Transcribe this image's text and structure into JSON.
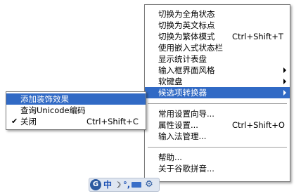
{
  "main_menu": {
    "items": [
      {
        "label": "切换为全角状态",
        "shortcut": ""
      },
      {
        "label": "切换为英文标点",
        "shortcut": ""
      },
      {
        "label": "切换为繁体模式",
        "shortcut": "Ctrl+Shift+T"
      },
      {
        "label": "使用嵌入式状态栏",
        "shortcut": ""
      },
      {
        "label": "显示统计表盘",
        "shortcut": ""
      },
      {
        "label": "输入框界面风格",
        "shortcut": "",
        "submenu": true
      },
      {
        "label": "软键盘",
        "shortcut": "",
        "submenu": true
      },
      {
        "label": "候选项转换器",
        "shortcut": "",
        "submenu": true,
        "selected": true
      },
      {
        "label": "常用设置向导...",
        "shortcut": ""
      },
      {
        "label": "属性设置...",
        "shortcut": "Ctrl+Shift+O"
      },
      {
        "label": "输入法管理...",
        "shortcut": ""
      },
      {
        "label": "帮助...",
        "shortcut": ""
      },
      {
        "label": "关于谷歌拼音...",
        "shortcut": ""
      }
    ]
  },
  "sub_menu": {
    "items": [
      {
        "label": "添加装饰效果",
        "shortcut": "",
        "selected": true
      },
      {
        "label": "查询Unicode编码",
        "shortcut": ""
      },
      {
        "label": "关闭",
        "shortcut": "Ctrl+Shift+C",
        "checked": true,
        "check_glyph": "✔"
      }
    ]
  },
  "toolbar": {
    "logo_text": "G",
    "mode_text": "中",
    "moon_icon": "☽",
    "punct_text": "°,",
    "gear_icon": "⚙"
  },
  "colors": {
    "selection": "#316ac5",
    "toolbar_bg": "#dfe6f1"
  }
}
